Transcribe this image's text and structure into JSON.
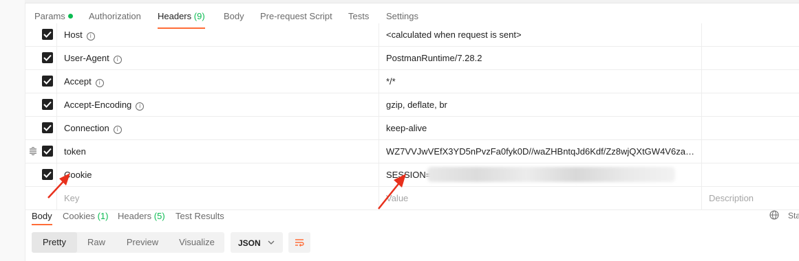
{
  "request_tabs": [
    {
      "label": "Params",
      "count": "",
      "dot": true
    },
    {
      "label": "Authorization",
      "count": ""
    },
    {
      "label": "Headers",
      "count": "(9)"
    },
    {
      "label": "Body",
      "count": ""
    },
    {
      "label": "Pre-request Script",
      "count": ""
    },
    {
      "label": "Tests",
      "count": ""
    },
    {
      "label": "Settings",
      "count": ""
    }
  ],
  "headers": [
    {
      "key": "Host",
      "value": "<calculated when request is sent>",
      "checked": true,
      "info": true
    },
    {
      "key": "User-Agent",
      "value": "PostmanRuntime/7.28.2",
      "checked": true,
      "info": true
    },
    {
      "key": "Accept",
      "value": "*/*",
      "checked": true,
      "info": true
    },
    {
      "key": "Accept-Encoding",
      "value": "gzip, deflate, br",
      "checked": true,
      "info": true
    },
    {
      "key": "Connection",
      "value": "keep-alive",
      "checked": true,
      "info": true
    },
    {
      "key": "token",
      "value": "WZ7VVJwVEfX3YD5nPvzFa0fyk0D//waZHBntqJd6Kdf/Zz8wjQXtGW4V6zaVjw...",
      "checked": true,
      "info": false
    },
    {
      "key": "Cookie",
      "value": "SESSION=",
      "checked": true,
      "info": false
    }
  ],
  "new_row": {
    "key_placeholder": "Key",
    "value_placeholder": "Value",
    "description_placeholder": "Description"
  },
  "response_tabs": [
    {
      "label": "Body",
      "count": ""
    },
    {
      "label": "Cookies",
      "count": "(1)"
    },
    {
      "label": "Headers",
      "count": "(5)"
    },
    {
      "label": "Test Results",
      "count": ""
    }
  ],
  "status_label": "Sta",
  "view_modes": [
    "Pretty",
    "Raw",
    "Preview",
    "Visualize"
  ],
  "format_select": {
    "value": "JSON"
  },
  "colors": {
    "accent": "#ff6c37",
    "count_green": "#0cbb52",
    "arrow_red": "#e8301c"
  }
}
